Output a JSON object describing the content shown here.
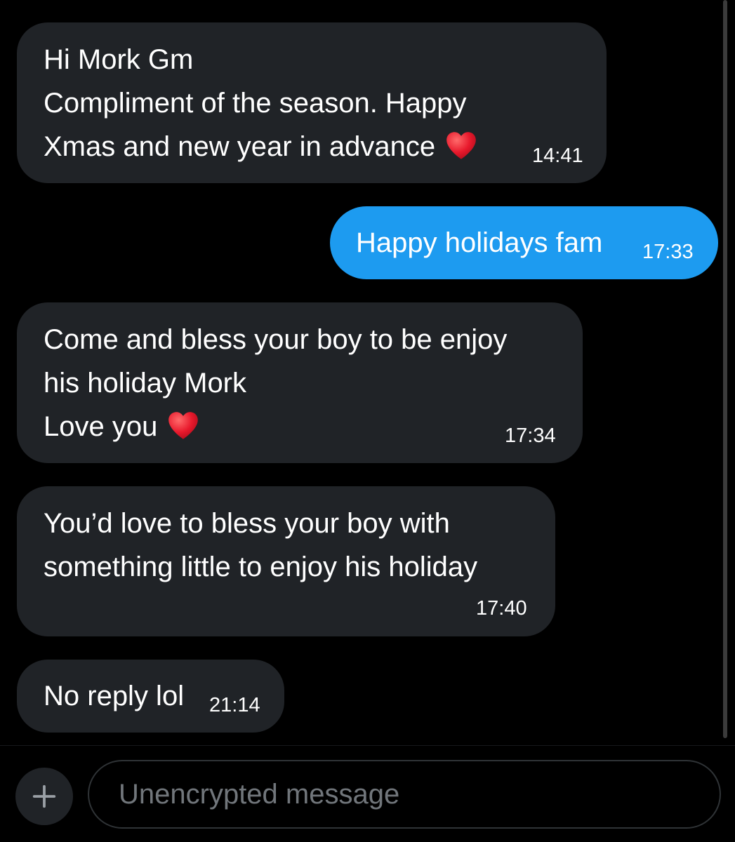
{
  "messages": [
    {
      "direction": "incoming",
      "lines": [
        "Hi Mork Gm",
        "Compliment of the season. Happy",
        "Xmas and new year in advance"
      ],
      "emoji": "red-heart-icon",
      "time": "14:41"
    },
    {
      "direction": "outgoing",
      "lines": [
        "Happy holidays fam"
      ],
      "time": "17:33"
    },
    {
      "direction": "incoming",
      "lines": [
        "Come and bless your boy to be enjoy",
        "his holiday Mork",
        "Love you"
      ],
      "emoji": "red-heart-icon",
      "time": "17:34"
    },
    {
      "direction": "incoming",
      "lines": [
        "You’d love to bless your boy with",
        "something little to enjoy his holiday"
      ],
      "time": "17:40"
    },
    {
      "direction": "incoming",
      "lines": [
        "No reply lol"
      ],
      "time": "21:14"
    }
  ],
  "composer": {
    "placeholder": "Unencrypted message",
    "add_icon": "plus-icon"
  },
  "colors": {
    "background": "#000000",
    "incoming_bubble": "#202327",
    "outgoing_bubble": "#1d9bf0",
    "text": "#ffffff",
    "placeholder": "#71767b",
    "heart": "#e8192c"
  }
}
